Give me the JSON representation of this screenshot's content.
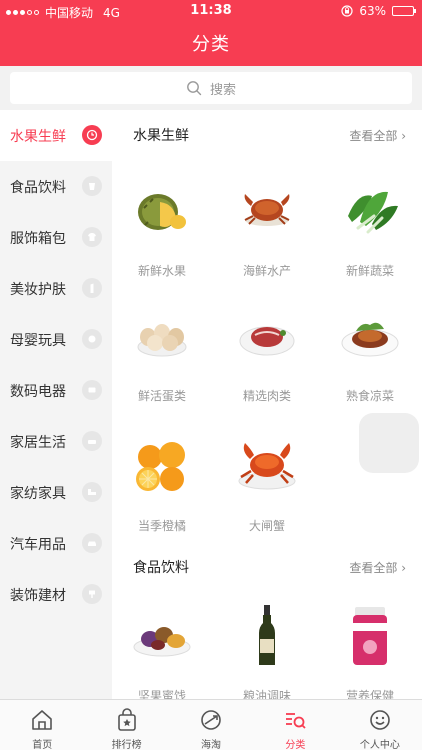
{
  "status_bar": {
    "carrier": "中国移动",
    "network": "4G",
    "time": "11:38",
    "battery": "63%",
    "battery_level": 0.63
  },
  "header": {
    "title": "分类"
  },
  "search": {
    "placeholder": "搜索"
  },
  "sidebar": {
    "items": [
      {
        "label": "水果生鲜",
        "active": true
      },
      {
        "label": "食品饮料"
      },
      {
        "label": "服饰箱包"
      },
      {
        "label": "美妆护肤"
      },
      {
        "label": "母婴玩具"
      },
      {
        "label": "数码电器"
      },
      {
        "label": "家居生活"
      },
      {
        "label": "家纺家具"
      },
      {
        "label": "汽车用品"
      },
      {
        "label": "装饰建材"
      }
    ]
  },
  "sections": [
    {
      "title": "水果生鲜",
      "more": "查看全部",
      "items": [
        {
          "label": "新鲜水果",
          "icon": "durian-icon"
        },
        {
          "label": "海鲜水产",
          "icon": "crab-icon"
        },
        {
          "label": "新鲜蔬菜",
          "icon": "vegetable-icon"
        },
        {
          "label": "鲜活蛋类",
          "icon": "eggs-icon"
        },
        {
          "label": "精选肉类",
          "icon": "steak-icon"
        },
        {
          "label": "熟食凉菜",
          "icon": "cooked-dish-icon"
        },
        {
          "label": "当季橙橘",
          "icon": "orange-icon"
        },
        {
          "label": "大闸蟹",
          "icon": "hairy-crab-icon"
        }
      ]
    },
    {
      "title": "食品饮料",
      "more": "查看全部",
      "items": [
        {
          "label": "坚果蜜饯",
          "icon": "nuts-icon"
        },
        {
          "label": "粮油调味",
          "icon": "oil-bottle-icon"
        },
        {
          "label": "营养保健",
          "icon": "supplement-icon"
        }
      ]
    }
  ],
  "tabbar": {
    "items": [
      {
        "label": "首页",
        "icon": "home-icon"
      },
      {
        "label": "排行榜",
        "icon": "ranking-bag-icon"
      },
      {
        "label": "海淘",
        "icon": "globe-plane-icon"
      },
      {
        "label": "分类",
        "icon": "category-search-icon",
        "active": true
      },
      {
        "label": "个人中心",
        "icon": "smiley-icon"
      }
    ]
  },
  "colors": {
    "brand": "#f73d52",
    "sidebar_bg": "#f4f4f4",
    "label_gray": "#999999"
  }
}
